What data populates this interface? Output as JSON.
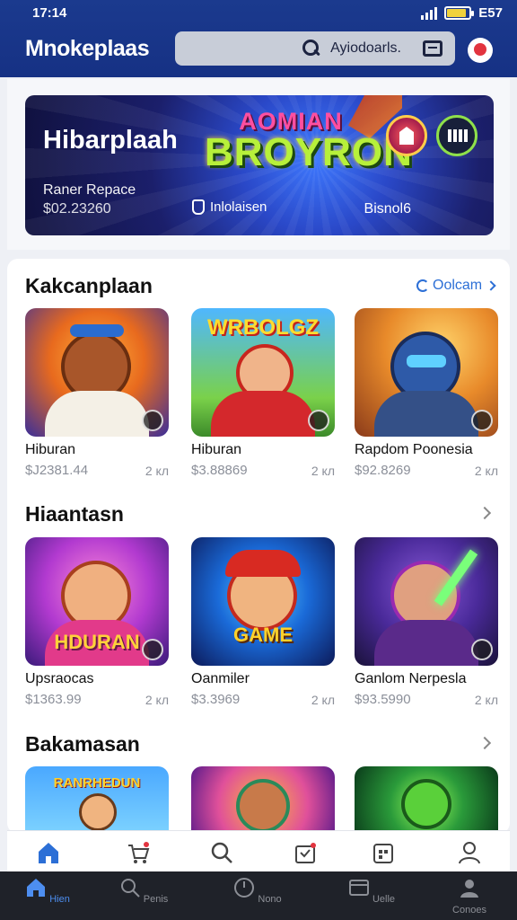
{
  "status": {
    "time": "17:14",
    "battery_text": "E57",
    "battery_level": 0.85
  },
  "header": {
    "brand": "Mnokeplaas",
    "search_placeholder": "Ayiodoarls."
  },
  "hero": {
    "title": "Hibarplaah",
    "logo_line1": "AOMIAN",
    "logo_line2": "BROYRON",
    "subtitle": "Raner Repace",
    "price": "$02.23260",
    "info_label": "Inlolaisen",
    "right_label": "Bisnol6"
  },
  "sections": [
    {
      "title": "Kakcanplaan",
      "link": "Oolcam",
      "items": [
        {
          "name": "Hiburan",
          "price": "$J2381.44",
          "meta": "2 кл",
          "art": "Bear"
        },
        {
          "name": "Hiburan",
          "price": "$3.88869",
          "meta": "2 кл",
          "art": "WRBOLGZ"
        },
        {
          "name": "Rapdom Poonesia",
          "price": "$92.8269",
          "meta": "2 кл",
          "art": "Hood"
        }
      ]
    },
    {
      "title": "Hiaantasn",
      "items": [
        {
          "name": "Upsraocas",
          "price": "$1363.99",
          "meta": "2 кл",
          "art": "HDURAN"
        },
        {
          "name": "Oanmiler",
          "price": "$3.3969",
          "meta": "2 кл",
          "art": "GAME"
        },
        {
          "name": "Ganlom Nerpesla",
          "price": "$93.5990",
          "meta": "2 кл",
          "art": "Mage"
        }
      ]
    },
    {
      "title": "Bakamasan",
      "items": [
        {
          "art": "RANRHEDUN"
        },
        {
          "art": "Warrior"
        },
        {
          "art": "Goblin"
        }
      ]
    }
  ],
  "nav_top": [
    "home-icon",
    "cart-icon",
    "search-icon",
    "bag-icon",
    "calendar-icon",
    "profile-icon"
  ],
  "nav_bottom": [
    {
      "label": "Hien",
      "icon": "home-icon"
    },
    {
      "label": "Penis",
      "icon": "search-icon"
    },
    {
      "label": "Nono",
      "icon": "clock-icon"
    },
    {
      "label": "Uelle",
      "icon": "wallet-icon"
    },
    {
      "label": "Conoes",
      "icon": "profile-icon"
    }
  ],
  "colors": {
    "header": "#1b3a8e",
    "accent": "#2c6fd6",
    "nav_active": "#4d8ef0"
  }
}
